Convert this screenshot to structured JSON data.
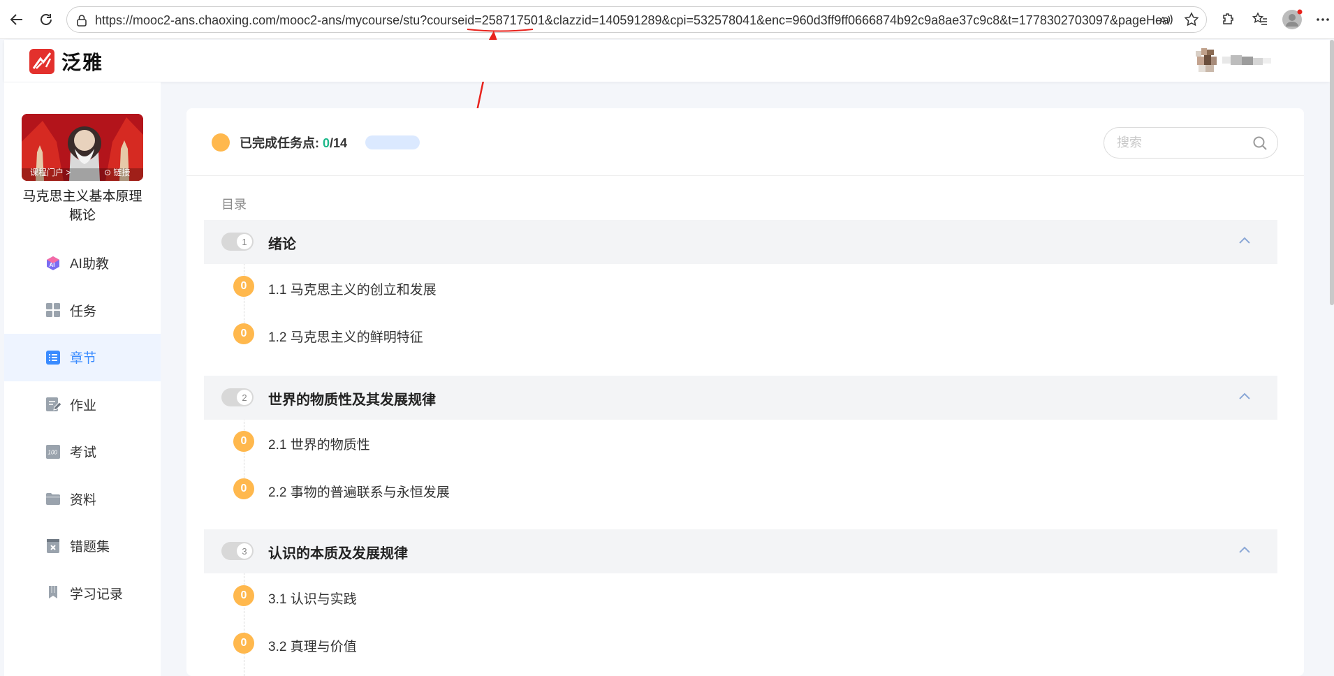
{
  "browser": {
    "url": "https://mooc2-ans.chaoxing.com/mooc2-ans/mycourse/stu?courseid=258717501&clazzid=140591289&cpi=532578041&enc=960d3ff9ff0666874b92c9a8ae37c9c8&t=1778302703097&pageHea..."
  },
  "header": {
    "logo_text": "泛雅"
  },
  "sidebar": {
    "cover_links": [
      "课程门户 >",
      "⊙ 链接"
    ],
    "course_title": "马克思主义基本原理概论",
    "items": [
      {
        "label": "AI助教",
        "icon": "ai-assistant-icon"
      },
      {
        "label": "任务",
        "icon": "grid-icon"
      },
      {
        "label": "章节",
        "icon": "list-icon",
        "active": true
      },
      {
        "label": "作业",
        "icon": "edit-icon"
      },
      {
        "label": "考试",
        "icon": "exam-icon"
      },
      {
        "label": "资料",
        "icon": "folder-icon"
      },
      {
        "label": "错题集",
        "icon": "wrong-book-icon"
      },
      {
        "label": "学习记录",
        "icon": "bookmark-icon"
      }
    ]
  },
  "main": {
    "progress": {
      "label": "已完成任务点: ",
      "done": "0",
      "total": "/14",
      "fraction": 0
    },
    "search": {
      "placeholder": "搜索"
    },
    "catalog_label": "目录",
    "chapters": [
      {
        "number": "1",
        "title": "绪论",
        "sections": [
          {
            "badge": "0",
            "title": "1.1 马克思主义的创立和发展"
          },
          {
            "badge": "0",
            "title": "1.2 马克思主义的鲜明特征"
          }
        ]
      },
      {
        "number": "2",
        "title": "世界的物质性及其发展规律",
        "sections": [
          {
            "badge": "0",
            "title": "2.1 世界的物质性"
          },
          {
            "badge": "0",
            "title": "2.2 事物的普遍联系与永恒发展"
          }
        ]
      },
      {
        "number": "3",
        "title": "认识的本质及发展规律",
        "sections": [
          {
            "badge": "0",
            "title": "3.1 认识与实践"
          },
          {
            "badge": "0",
            "title": "3.2 真理与价值"
          }
        ]
      }
    ]
  },
  "colors": {
    "accent": "#3a8bff",
    "badge": "#ffb84d",
    "done": "#1db88a",
    "annotation": "#e8231d"
  }
}
